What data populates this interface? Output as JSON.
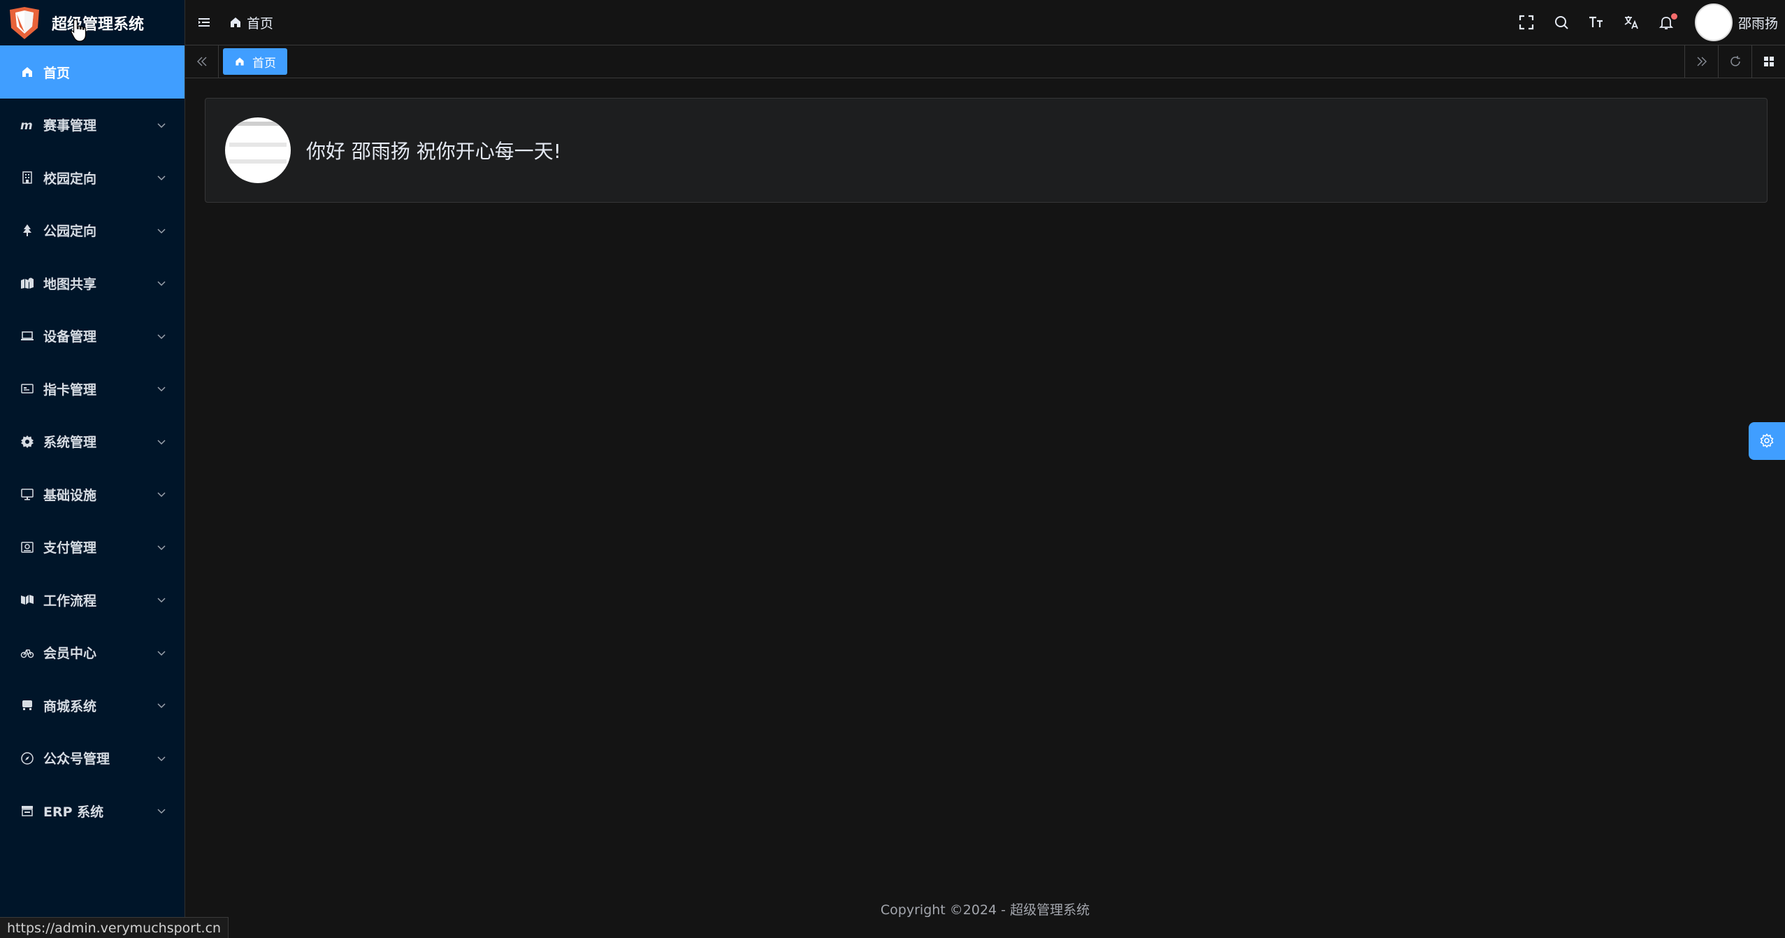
{
  "app": {
    "title": "超级管理系统"
  },
  "sidebar": {
    "items": [
      {
        "label": "首页",
        "icon": "home-icon",
        "active": true
      },
      {
        "label": "赛事管理",
        "icon": "m-logo-icon"
      },
      {
        "label": "校园定向",
        "icon": "building-icon"
      },
      {
        "label": "公园定向",
        "icon": "tree-icon"
      },
      {
        "label": "地图共享",
        "icon": "map-icon"
      },
      {
        "label": "设备管理",
        "icon": "laptop-icon"
      },
      {
        "label": "指卡管理",
        "icon": "card-icon"
      },
      {
        "label": "系统管理",
        "icon": "gear-icon"
      },
      {
        "label": "基础设施",
        "icon": "monitor-icon"
      },
      {
        "label": "支付管理",
        "icon": "wallet-icon"
      },
      {
        "label": "工作流程",
        "icon": "flow-icon"
      },
      {
        "label": "会员中心",
        "icon": "bicycle-icon"
      },
      {
        "label": "商城系统",
        "icon": "store-icon"
      },
      {
        "label": "公众号管理",
        "icon": "compass-icon"
      },
      {
        "label": "ERP 系统",
        "icon": "shop-icon"
      }
    ]
  },
  "header": {
    "breadcrumb": "首页",
    "username": "邵雨扬",
    "icons": [
      "fullscreen-icon",
      "search-icon",
      "font-size-icon",
      "translate-icon",
      "bell-icon"
    ]
  },
  "tabs": {
    "items": [
      {
        "label": "首页",
        "active": true
      }
    ]
  },
  "main": {
    "welcome": "你好 邵雨扬 祝你开心每一天!"
  },
  "footer": {
    "copyright": "Copyright ©2024 - 超级管理系统"
  },
  "status": {
    "url": "https://admin.verymuchsport.cn"
  },
  "colors": {
    "accent": "#409eff",
    "sidebar_bg": "#001529",
    "page_bg": "#141414",
    "card_bg": "#1d1e1f",
    "notice_dot": "#f56c6c"
  }
}
